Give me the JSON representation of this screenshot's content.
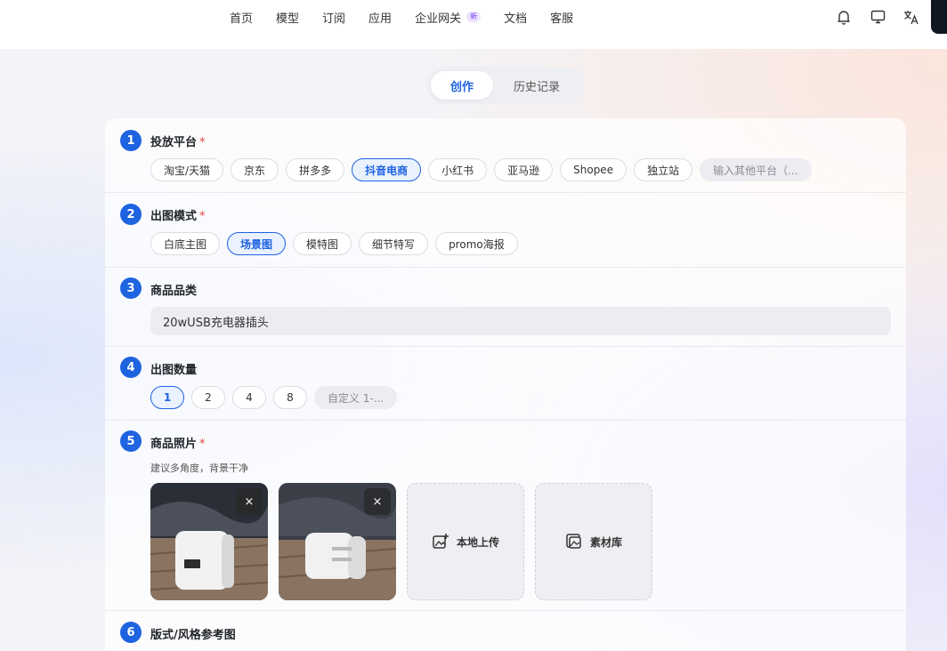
{
  "nav": {
    "items": [
      "首页",
      "模型",
      "订阅",
      "应用",
      "企业网关",
      "文档",
      "客服"
    ],
    "badge": "新"
  },
  "tabs": {
    "create": "创作",
    "history": "历史记录"
  },
  "sections": {
    "platform": {
      "num": "1",
      "title": "投放平台",
      "required": "*",
      "options": [
        "淘宝/天猫",
        "京东",
        "拼多多",
        "抖音电商",
        "小红书",
        "亚马逊",
        "Shopee",
        "独立站"
      ],
      "selected": "抖音电商",
      "custom_placeholder": "输入其他平台（..."
    },
    "mode": {
      "num": "2",
      "title": "出图模式",
      "required": "*",
      "options": [
        "白底主图",
        "场景图",
        "模特图",
        "细节特写",
        "promo海报"
      ],
      "selected": "场景图"
    },
    "category": {
      "num": "3",
      "title": "商品品类",
      "value": "20wUSB充电器插头"
    },
    "count": {
      "num": "4",
      "title": "出图数量",
      "options": [
        "1",
        "2",
        "4",
        "8"
      ],
      "selected": "1",
      "custom_placeholder": "自定义 1-..."
    },
    "photos": {
      "num": "5",
      "title": "商品照片",
      "required": "*",
      "hint": "建议多角度，背景干净",
      "close_label": "×",
      "local_upload": "本地上传",
      "library": "素材库"
    },
    "style": {
      "num": "6",
      "title": "版式/风格参考图"
    }
  },
  "colors": {
    "accent": "#1e63e0",
    "required": "#e5463c"
  },
  "icons": [
    "bell-icon",
    "monitor-icon",
    "translate-icon",
    "close-icon",
    "image-upload-icon",
    "gallery-icon"
  ]
}
